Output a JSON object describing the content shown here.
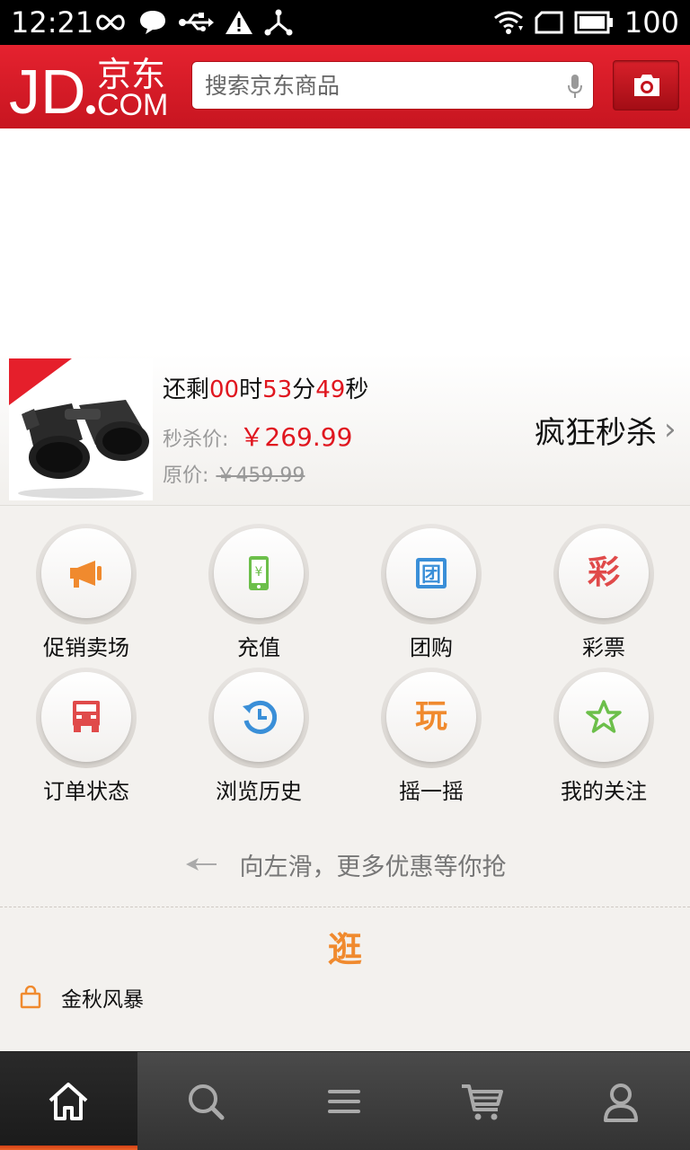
{
  "status_bar": {
    "time": "12:21",
    "battery": "100"
  },
  "header": {
    "logo_text": "JD.京东.COM",
    "search_placeholder": "搜索京东商品"
  },
  "seckill": {
    "countdown_prefix": "还剩",
    "hours": "00",
    "hours_unit": "时",
    "minutes": "53",
    "minutes_unit": "分",
    "seconds": "49",
    "seconds_unit": "秒",
    "price_label": "秒杀价:",
    "price": "￥269.99",
    "original_label": "原价:",
    "original_price": "￥459.99",
    "title": "疯狂秒杀",
    "chevron": "›"
  },
  "grid": {
    "items": [
      {
        "label": "促销卖场",
        "icon": "megaphone-icon",
        "color": "#f08a2e"
      },
      {
        "label": "充值",
        "icon": "phone-recharge-icon",
        "color": "#6cbf4a"
      },
      {
        "label": "团购",
        "icon": "group-buy-icon",
        "color": "#3a8fd8",
        "glyph": "团"
      },
      {
        "label": "彩票",
        "icon": "lottery-icon",
        "color": "#e04a4a",
        "glyph": "彩"
      },
      {
        "label": "订单状态",
        "icon": "truck-icon",
        "color": "#e04a4a"
      },
      {
        "label": "浏览历史",
        "icon": "history-icon",
        "color": "#3a8fd8"
      },
      {
        "label": "摇一摇",
        "icon": "shake-icon",
        "color": "#f08a2e",
        "glyph": "玩"
      },
      {
        "label": "我的关注",
        "icon": "star-icon",
        "color": "#6cbf4a"
      }
    ]
  },
  "swipe_hint": "向左滑，更多优惠等你抢",
  "section_title": "逛",
  "feature": {
    "label": "金秋风暴"
  },
  "tabbar": {
    "tabs": [
      {
        "icon": "home-icon",
        "active": true
      },
      {
        "icon": "search-icon",
        "active": false
      },
      {
        "icon": "menu-icon",
        "active": false
      },
      {
        "icon": "cart-icon",
        "active": false
      },
      {
        "icon": "user-icon",
        "active": false
      }
    ]
  },
  "colors": {
    "brand_red": "#e5222f",
    "price_red": "#e0161f",
    "orange": "#f08a2e"
  }
}
